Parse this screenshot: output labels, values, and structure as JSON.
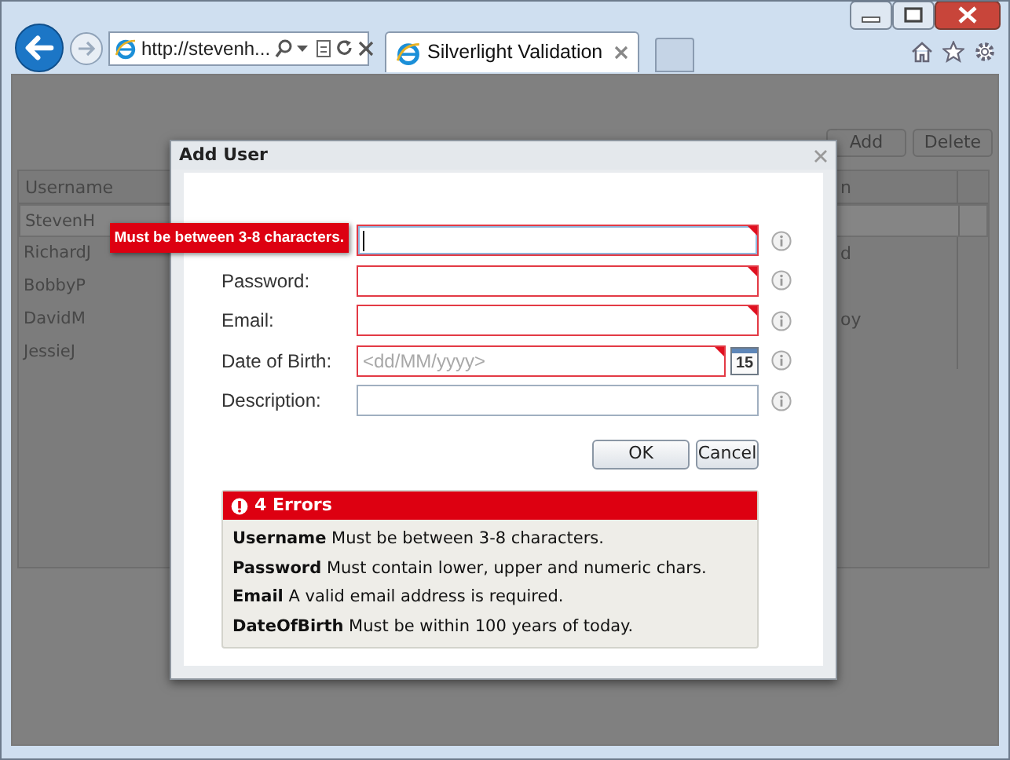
{
  "browser": {
    "address": "http://stevenh...",
    "tabs": [
      {
        "label": "Silverlight Validation",
        "selected": true
      }
    ]
  },
  "toolbar": {
    "buttons": [
      "Add",
      "Delete"
    ]
  },
  "grid": {
    "columns": [
      "Username",
      "n"
    ],
    "rows": [
      {
        "username": "StevenH",
        "selected": true
      },
      {
        "username": "RichardJ",
        "column_2": "d",
        "selected": false
      },
      {
        "username": "BobbyP",
        "selected": false
      },
      {
        "username": "DavidM",
        "column_2": "oy",
        "selected": false
      },
      {
        "username": "JessieJ",
        "selected": false
      }
    ]
  },
  "dialog": {
    "title": "Add User",
    "fields": [
      {
        "kind": "text",
        "invalid": true,
        "focused": true,
        "tooltip": "Must be between 3-8 characters."
      },
      {
        "kind": "text",
        "label": "Password:",
        "invalid": true,
        "focused": false
      },
      {
        "kind": "text",
        "label": "Email:",
        "invalid": true,
        "focused": false
      },
      {
        "kind": "date",
        "label": "Date of Birth:",
        "placeholder": "<dd/MM/yyyy>",
        "calendar_label": "15",
        "invalid": true,
        "focused": false
      },
      {
        "kind": "text",
        "label": "Description:",
        "invalid": false,
        "focused": false
      }
    ],
    "buttons": [
      "OK",
      "Cancel"
    ],
    "error_summary": {
      "title": "4 Errors",
      "items": [
        {
          "field": "Username",
          "message": "Must be between 3-8 characters."
        },
        {
          "field": "Password",
          "message": "Must contain lower, upper and numeric chars."
        },
        {
          "field": "Email",
          "message": "A valid email address is required."
        },
        {
          "field": "DateOfBirth",
          "message": "Must be within 100 years of today."
        }
      ]
    }
  }
}
